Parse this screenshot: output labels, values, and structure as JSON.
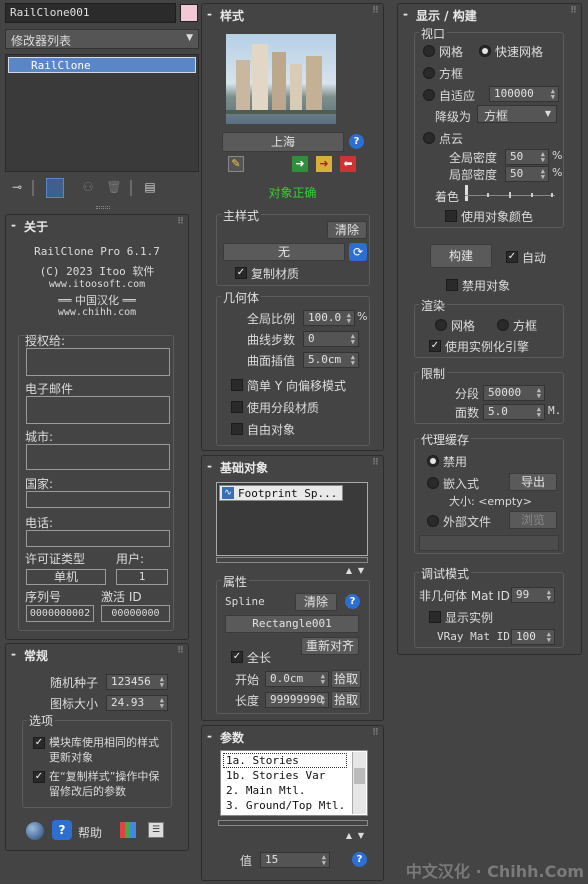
{
  "left": {
    "object_name": "RailClone001",
    "modifier_list": "修改器列表",
    "stack_item": "RailClone",
    "about": {
      "title": "关于",
      "line1": "RailClone Pro 6.1.7",
      "line2": "(C) 2023 Itoo 软件",
      "line3": "www.itoosoft.com",
      "line4": "══ 中国汉化 ══",
      "line5": "www.chihh.com",
      "licensed_to": "授权给:",
      "email": "电子邮件",
      "city": "城市:",
      "country": "国家:",
      "phone": "电话:",
      "license_type_label": "许可证类型",
      "users_label": "用户:",
      "license_type_value": "单机",
      "users_value": "1",
      "serial_label": "序列号",
      "activation_label": "激活 ID",
      "serial_value": "0000000002",
      "activation_value": "00000000"
    },
    "general": {
      "title": "常规",
      "seed_label": "随机种子",
      "seed_value": "123456",
      "icon_size_label": "图标大小",
      "icon_size_value": "24.93",
      "options_label": "选项",
      "opt1": "模块库使用相同的样式更新对象",
      "opt2": "在“复制样式”操作中保留修改后的参数",
      "help": "帮助"
    }
  },
  "mid": {
    "style_title": "样式",
    "style_name": "上海",
    "status": "对象正确",
    "master_style_label": "主样式",
    "clear": "清除",
    "none": "无",
    "copy_material": "复制材质",
    "geometry_label": "几何体",
    "global_scale_label": "全局比例",
    "global_scale_value": "100.0",
    "global_scale_unit": "%",
    "curve_steps_label": "曲线步数",
    "curve_steps_value": "0",
    "curve_interp_label": "曲面插值",
    "curve_interp_value": "5.0cm",
    "simple_y": "简单 Y 向偏移模式",
    "seg_material": "使用分段材质",
    "free_object": "自由对象",
    "base_title": "基础对象",
    "base_item": "Footprint Sp...",
    "props_label": "属性",
    "spline_label": "Spline",
    "props_clear": "清除",
    "spline_value": "Rectangle001",
    "realign": "重新对齐",
    "full_length": "全长",
    "start_label": "开始",
    "start_value": "0.0cm",
    "pick1": "拾取",
    "length_label": "长度",
    "length_value": "99999990",
    "pick2": "拾取",
    "params_title": "参数",
    "params": [
      "1a. Stories",
      "1b. Stories Var",
      "2. Main Mtl.",
      "3. Ground/Top Mtl."
    ],
    "value_label": "值",
    "value_value": "15"
  },
  "right": {
    "title": "显示 / 构建",
    "viewport_label": "视口",
    "mesh": "网格",
    "fast_mesh": "快速网格",
    "box": "方框",
    "adaptive": "自适应",
    "adaptive_value": "100000",
    "degrade_label": "降级为",
    "degrade_value": "方框",
    "pointcloud": "点云",
    "global_density_label": "全局密度",
    "global_density_value": "50",
    "local_density_label": "局部密度",
    "local_density_value": "50",
    "pct": "%",
    "coloring_label": "着色",
    "use_obj_color": "使用对象颜色",
    "build": "构建",
    "auto": "自动",
    "disable_object": "禁用对象",
    "render_label": "渲染",
    "render_mesh": "网格",
    "render_box": "方框",
    "use_instancing": "使用实例化引擎",
    "limits_label": "限制",
    "segments_label": "分段",
    "segments_value": "50000",
    "faces_label": "面数",
    "faces_value": "5.0",
    "faces_unit": "M.",
    "proxy_label": "代理缓存",
    "disable": "禁用",
    "embedded": "嵌入式",
    "export": "导出",
    "size_label": "大小: <empty>",
    "external_file": "外部文件",
    "browse": "浏览",
    "debug_label": "调试模式",
    "nonmesh_label": "非几何体 Mat ID",
    "nonmesh_value": "99",
    "show_instances": "显示实例",
    "vray_label": "VRay Mat ID",
    "vray_value": "100"
  },
  "watermark": "中文汉化 · Chihh.Com",
  "colors": {
    "bg": "#444444",
    "accent": "#5a86c8",
    "ok": "#2fd22f",
    "swatch": "#f3c7d4"
  }
}
